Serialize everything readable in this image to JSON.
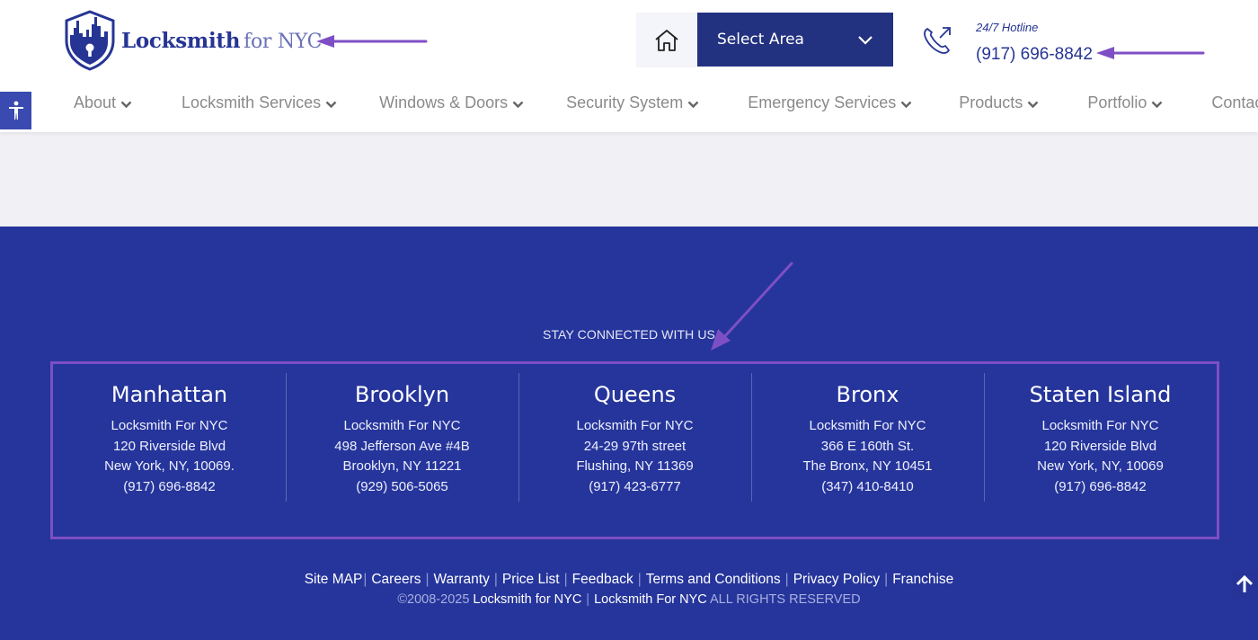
{
  "header": {
    "logo": {
      "bold": "Locksmith",
      "thin": "for NYC",
      "icon": "shield-skyline-keyhole-icon"
    },
    "home_icon": "home-icon",
    "select_area": {
      "label": "Select Area",
      "icon": "chevron-down-icon"
    },
    "hotline": {
      "icon": "phone-outgoing-icon",
      "label": "24/7 Hotline",
      "number": "(917) 696-8842"
    },
    "accessibility_icon": "accessibility-icon"
  },
  "nav": {
    "items": [
      {
        "label": "About",
        "has_dropdown": true
      },
      {
        "label": "Locksmith Services",
        "has_dropdown": true
      },
      {
        "label": "Windows & Doors",
        "has_dropdown": true
      },
      {
        "label": "Security System",
        "has_dropdown": true
      },
      {
        "label": "Emergency Services",
        "has_dropdown": true
      },
      {
        "label": "Products",
        "has_dropdown": true
      },
      {
        "label": "Portfolio",
        "has_dropdown": true
      },
      {
        "label": "Contact",
        "has_dropdown": false
      }
    ]
  },
  "footer": {
    "stay_connected": "STAY CONNECTED WITH US",
    "offices": [
      {
        "city": "Manhattan",
        "name": "Locksmith For NYC",
        "street": "120 Riverside Blvd",
        "locality": "New York, NY, 10069.",
        "phone": "(917) 696-8842"
      },
      {
        "city": "Brooklyn",
        "name": "Locksmith For NYC",
        "street": "498 Jefferson Ave #4B",
        "locality": "Brooklyn, NY 11221",
        "phone": "(929) 506-5065"
      },
      {
        "city": "Queens",
        "name": "Locksmith For NYC",
        "street": "24-29 97th street",
        "locality": "Flushing, NY 11369",
        "phone": "(917) 423-6777"
      },
      {
        "city": "Bronx",
        "name": "Locksmith For NYC",
        "street": "366 E 160th St.",
        "locality": "The Bronx, NY 10451",
        "phone": "(347) 410-8410"
      },
      {
        "city": "Staten Island",
        "name": "Locksmith For NYC",
        "street": "120 Riverside Blvd",
        "locality": "New York, NY, 10069",
        "phone": "(917) 696-8842"
      }
    ],
    "links": [
      "Site MAP",
      "Careers",
      "Warranty",
      "Price List",
      "Feedback",
      "Terms and Conditions",
      "Privacy Policy",
      "Franchise"
    ],
    "copyright": {
      "years": "©2008-2025",
      "brand1": "Locksmith for NYC",
      "brand2": "Locksmith For NYC",
      "rights": "ALL RIGHTS RESERVED"
    },
    "back_to_top_icon": "arrow-up-icon"
  },
  "annotations": {
    "color": "#7e4fc4",
    "arrows": [
      "arrow-to-logo",
      "arrow-to-hotline",
      "arrow-to-stay-connected"
    ],
    "highlight": "offices-box"
  },
  "colors": {
    "brand": "#263594",
    "footer_bg": "#26359b",
    "select_bg": "#233280",
    "nav_text": "#8a8a8a",
    "page_bg": "#f1f1f5"
  }
}
